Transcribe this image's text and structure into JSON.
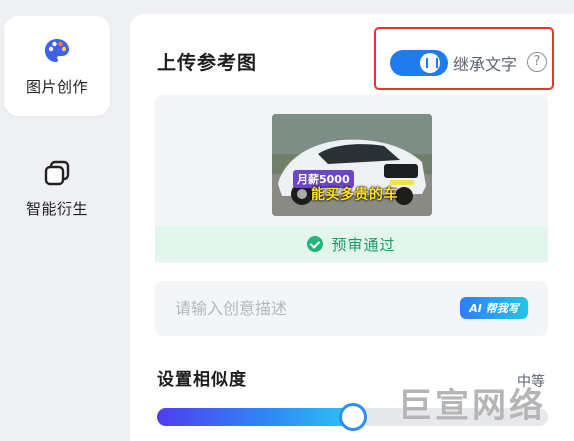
{
  "sidebar": {
    "items": [
      {
        "label": "图片创作",
        "icon": "palette-icon",
        "active": true
      },
      {
        "label": "智能衍生",
        "icon": "layers-icon",
        "active": false
      }
    ]
  },
  "upload": {
    "title": "上传参考图",
    "inherit_text_toggle": {
      "label": "继承文字",
      "on": true
    },
    "help_symbol": "?",
    "thumbnail": {
      "caption_line1": "月薪5000",
      "caption_line2": "能买多贵的车"
    },
    "review_status": "预审通过"
  },
  "prompt": {
    "placeholder": "请输入创意描述",
    "value": "",
    "ai_button_label": "AI 帮我写"
  },
  "similarity": {
    "title": "设置相似度",
    "level_label": "中等",
    "value_fraction": 0.5
  },
  "watermark": "巨宣网络",
  "colors": {
    "accent": "#1f7cf0",
    "success": "#24b57a",
    "highlight_border": "#e8352b"
  }
}
